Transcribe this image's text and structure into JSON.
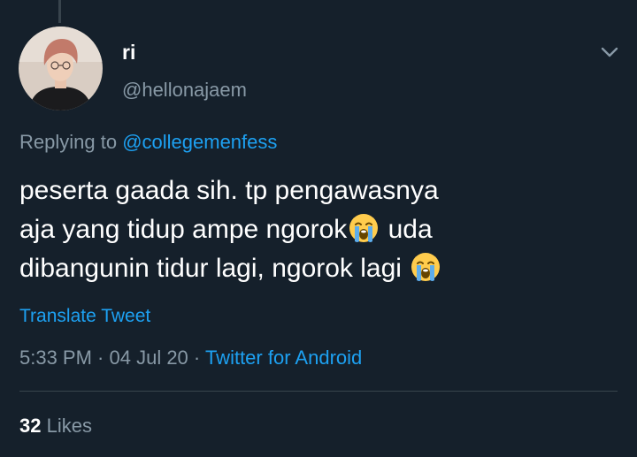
{
  "tweet": {
    "display_name": "ri",
    "handle": "@hellonajaem",
    "replying_prefix": "Replying to ",
    "replying_to": "@collegemenfess",
    "body": {
      "line1": "peserta gaada sih. tp pengawasnya",
      "line2a": "aja yang tidup ampe ngorok",
      "line2b": " uda",
      "line3a": "dibangunin tidur lagi, ngorok lagi "
    },
    "emoji_name": "loudly-crying-face",
    "translate_label": "Translate Tweet",
    "time": "5:33 PM",
    "separator": " · ",
    "date": "04 Jul 20",
    "source": "Twitter for Android",
    "likes_count": "32",
    "likes_label": " Likes"
  },
  "colors": {
    "background": "#15202b",
    "primary_text": "#ffffff",
    "secondary_text": "#8899a6",
    "accent": "#1da1f2",
    "divider": "#38444d"
  }
}
